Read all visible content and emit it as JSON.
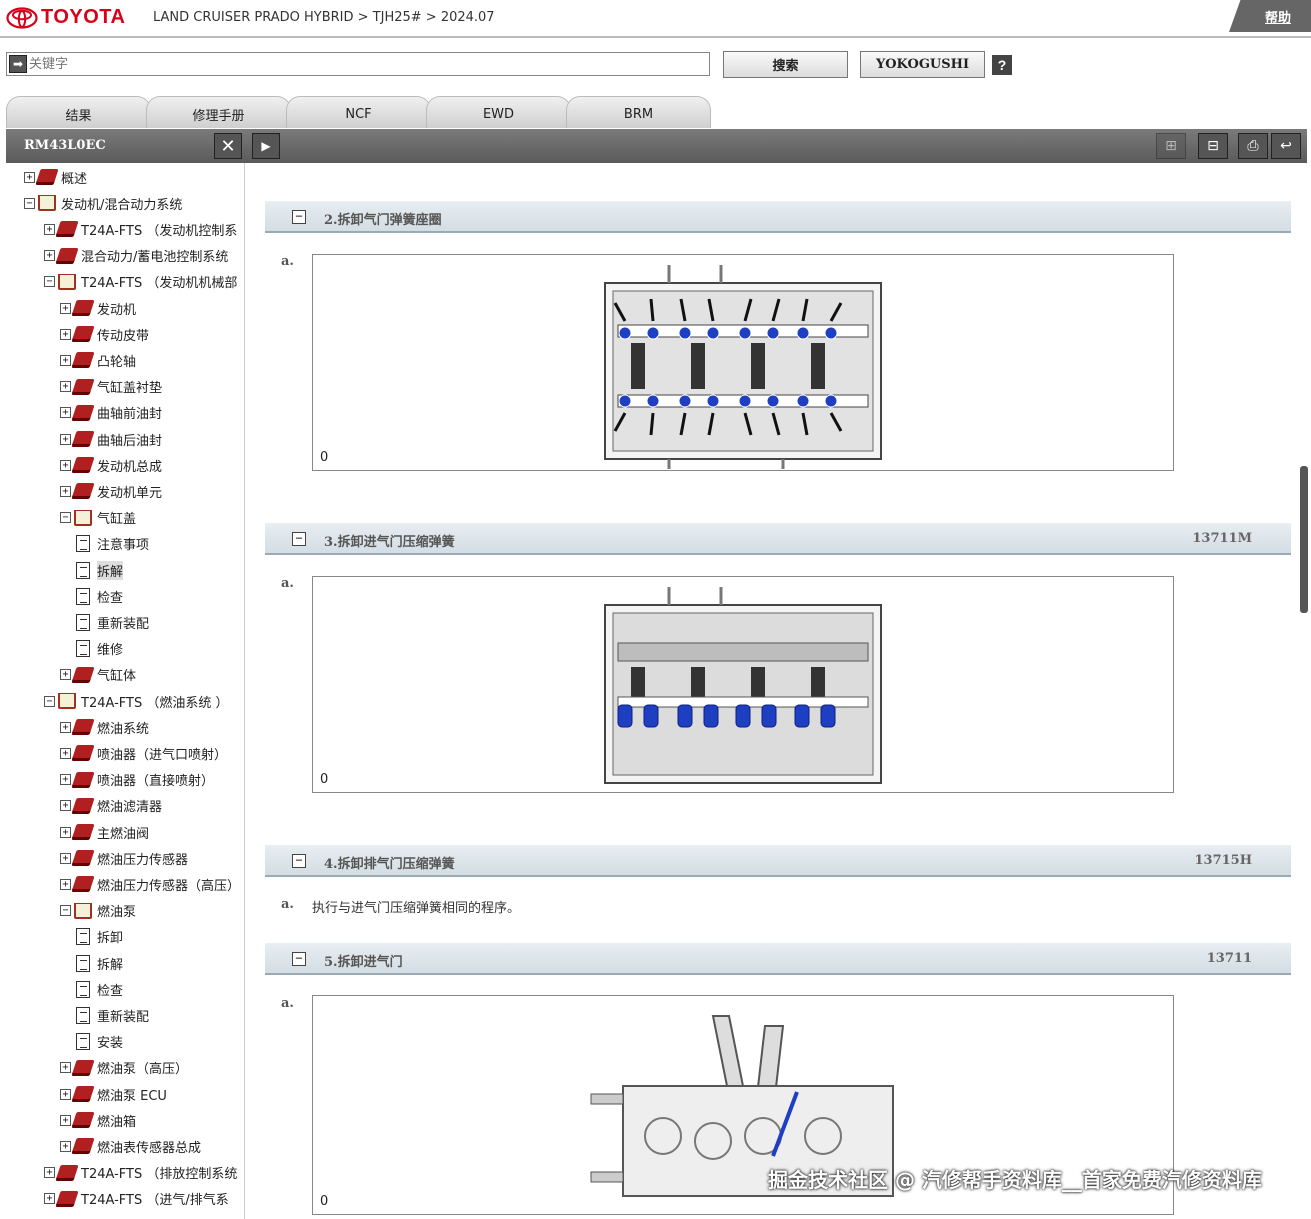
{
  "header": {
    "brand": "TOYOTA",
    "breadcrumb": "LAND CRUISER PRADO HYBRID > TJH25# > 2024.07",
    "help_label": "帮助"
  },
  "search": {
    "placeholder": "关键字",
    "search_button": "搜索",
    "yoko_button": "YOKOGUSHI",
    "help_button": "?"
  },
  "tabs": [
    "结果",
    "修理手册",
    "NCF",
    "EWD",
    "BRM"
  ],
  "toolbar": {
    "doc_id": "RM43L0EC",
    "close": "✕",
    "next": "▶"
  },
  "tree": [
    {
      "label": "概述",
      "icon": "closed-book-icon",
      "toggle": "+",
      "level": 0
    },
    {
      "label": "发动机/混合动力系统",
      "icon": "open-book-icon",
      "toggle": "−",
      "level": 0
    },
    {
      "label": "T24A-FTS （发动机控制系",
      "icon": "closed-book-icon",
      "toggle": "+",
      "level": 1
    },
    {
      "label": "混合动力/蓄电池控制系统",
      "icon": "closed-book-icon",
      "toggle": "+",
      "level": 1
    },
    {
      "label": "T24A-FTS （发动机机械部",
      "icon": "open-book-icon",
      "toggle": "−",
      "level": 1
    },
    {
      "label": "发动机",
      "icon": "closed-book-icon",
      "toggle": "+",
      "level": 2
    },
    {
      "label": "传动皮带",
      "icon": "closed-book-icon",
      "toggle": "+",
      "level": 2
    },
    {
      "label": "凸轮轴",
      "icon": "closed-book-icon",
      "toggle": "+",
      "level": 2
    },
    {
      "label": "气缸盖衬垫",
      "icon": "closed-book-icon",
      "toggle": "+",
      "level": 2
    },
    {
      "label": "曲轴前油封",
      "icon": "closed-book-icon",
      "toggle": "+",
      "level": 2
    },
    {
      "label": "曲轴后油封",
      "icon": "closed-book-icon",
      "toggle": "+",
      "level": 2
    },
    {
      "label": "发动机总成",
      "icon": "closed-book-icon",
      "toggle": "+",
      "level": 2
    },
    {
      "label": "发动机单元",
      "icon": "closed-book-icon",
      "toggle": "+",
      "level": 2
    },
    {
      "label": "气缸盖",
      "icon": "open-book-icon",
      "toggle": "−",
      "level": 2
    },
    {
      "label": "注意事项",
      "icon": "document-icon",
      "toggle": "",
      "level": 3
    },
    {
      "label": "拆解",
      "icon": "document-icon",
      "toggle": "",
      "level": 3,
      "selected": true
    },
    {
      "label": "检查",
      "icon": "document-icon",
      "toggle": "",
      "level": 3
    },
    {
      "label": "重新装配",
      "icon": "document-icon",
      "toggle": "",
      "level": 3
    },
    {
      "label": "维修",
      "icon": "document-icon",
      "toggle": "",
      "level": 3
    },
    {
      "label": "气缸体",
      "icon": "closed-book-icon",
      "toggle": "+",
      "level": 2
    },
    {
      "label": "T24A-FTS （燃油系统 ）",
      "icon": "open-book-icon",
      "toggle": "−",
      "level": 1
    },
    {
      "label": "燃油系统",
      "icon": "closed-book-icon",
      "toggle": "+",
      "level": 2
    },
    {
      "label": "喷油器（进气口喷射）",
      "icon": "closed-book-icon",
      "toggle": "+",
      "level": 2
    },
    {
      "label": "喷油器（直接喷射）",
      "icon": "closed-book-icon",
      "toggle": "+",
      "level": 2
    },
    {
      "label": "燃油滤清器",
      "icon": "closed-book-icon",
      "toggle": "+",
      "level": 2
    },
    {
      "label": "主燃油阀",
      "icon": "closed-book-icon",
      "toggle": "+",
      "level": 2
    },
    {
      "label": "燃油压力传感器",
      "icon": "closed-book-icon",
      "toggle": "+",
      "level": 2
    },
    {
      "label": "燃油压力传感器（高压）",
      "icon": "closed-book-icon",
      "toggle": "+",
      "level": 2
    },
    {
      "label": "燃油泵",
      "icon": "open-book-icon",
      "toggle": "−",
      "level": 2
    },
    {
      "label": "拆卸",
      "icon": "document-icon",
      "toggle": "",
      "level": 3
    },
    {
      "label": "拆解",
      "icon": "document-icon",
      "toggle": "",
      "level": 3
    },
    {
      "label": "检查",
      "icon": "document-icon",
      "toggle": "",
      "level": 3
    },
    {
      "label": "重新装配",
      "icon": "document-icon",
      "toggle": "",
      "level": 3
    },
    {
      "label": "安装",
      "icon": "document-icon",
      "toggle": "",
      "level": 3
    },
    {
      "label": "燃油泵（高压）",
      "icon": "closed-book-icon",
      "toggle": "+",
      "level": 2
    },
    {
      "label": "燃油泵 ECU",
      "icon": "closed-book-icon",
      "toggle": "+",
      "level": 2
    },
    {
      "label": "燃油箱",
      "icon": "closed-book-icon",
      "toggle": "+",
      "level": 2
    },
    {
      "label": "燃油表传感器总成",
      "icon": "closed-book-icon",
      "toggle": "+",
      "level": 2
    },
    {
      "label": "T24A-FTS （排放控制系统",
      "icon": "closed-book-icon",
      "toggle": "+",
      "level": 1
    },
    {
      "label": "T24A-FTS （进气/排气系",
      "icon": "closed-book-icon",
      "toggle": "+",
      "level": 1
    }
  ],
  "sections": [
    {
      "title": "2.拆卸气门弹簧座圈",
      "code": "",
      "step": "a.",
      "figure": "0",
      "text": ""
    },
    {
      "title": "3.拆卸进气门压缩弹簧",
      "code": "13711M",
      "step": "a.",
      "figure": "0",
      "text": ""
    },
    {
      "title": "4.拆卸排气门压缩弹簧",
      "code": "13715H",
      "step": "a.",
      "figure": "",
      "text": "执行与进气门压缩弹簧相同的程序。"
    },
    {
      "title": "5.拆卸进气门",
      "code": "13711",
      "step": "a.",
      "figure": "0",
      "text": ""
    }
  ],
  "watermark": "掘金技术社区 @ 汽修帮手资料库__首家免费汽修资料库",
  "colors": {
    "toyota_red": "#d9001b",
    "toolbar": "#5b5b5b",
    "section_header": "#d3dde3",
    "highlight_blue": "#1f3fc2"
  }
}
